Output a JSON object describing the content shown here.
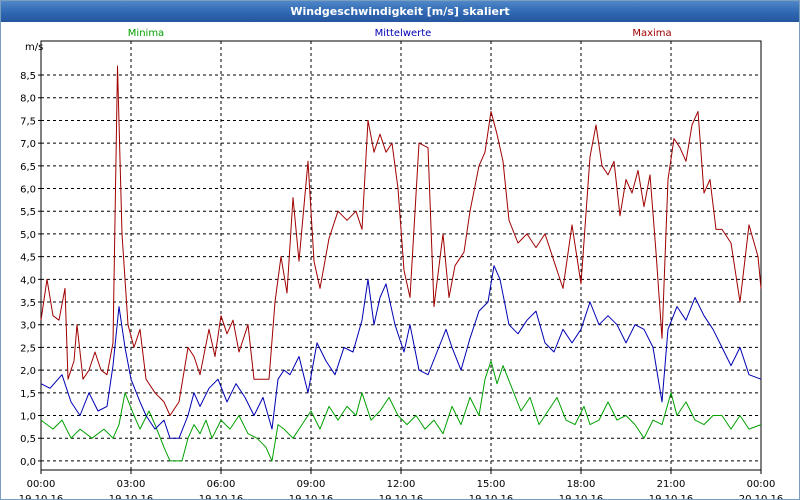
{
  "window": {
    "title": "Windgeschwindigkeit [m/s] skaliert"
  },
  "colors": {
    "minima": "#00a000",
    "mittel": "#0000b4",
    "maxima": "#a00000",
    "grid": "#000000"
  },
  "chart_data": {
    "type": "line",
    "title": "Windgeschwindigkeit [m/s] skaliert",
    "ylabel": "m/s",
    "ylim": [
      -0.2,
      9.25
    ],
    "yticks": [
      "0,0",
      "0,5",
      "1,0",
      "1,5",
      "2,0",
      "2,5",
      "3,0",
      "3,5",
      "4,0",
      "4,5",
      "5,0",
      "5,5",
      "6,0",
      "6,5",
      "7,0",
      "7,5",
      "8,0",
      "8,5"
    ],
    "xlim": [
      0,
      24
    ],
    "xticks": [
      {
        "time": "00:00",
        "date": "19.10.16"
      },
      {
        "time": "03:00",
        "date": "19.10.16"
      },
      {
        "time": "06:00",
        "date": "19.10.16"
      },
      {
        "time": "09:00",
        "date": "19.10.16"
      },
      {
        "time": "12:00",
        "date": "19.10.16"
      },
      {
        "time": "15:00",
        "date": "19.10.16"
      },
      {
        "time": "18:00",
        "date": "19.10.16"
      },
      {
        "time": "21:00",
        "date": "19.10.16"
      },
      {
        "time": "00:00",
        "date": "20.10.16"
      }
    ],
    "grid": true,
    "legend": [
      {
        "name": "Minima",
        "position": "top-left"
      },
      {
        "name": "Mittelwerte",
        "position": "top-center"
      },
      {
        "name": "Maxima",
        "position": "top-right"
      }
    ],
    "series": [
      {
        "name": "Minima",
        "points": [
          [
            0,
            0.9
          ],
          [
            0.4,
            0.7
          ],
          [
            0.7,
            0.9
          ],
          [
            1.0,
            0.5
          ],
          [
            1.3,
            0.7
          ],
          [
            1.7,
            0.5
          ],
          [
            2.1,
            0.7
          ],
          [
            2.4,
            0.5
          ],
          [
            2.6,
            0.8
          ],
          [
            2.8,
            1.5
          ],
          [
            3.1,
            1.0
          ],
          [
            3.3,
            0.7
          ],
          [
            3.6,
            1.1
          ],
          [
            3.8,
            0.8
          ],
          [
            4.1,
            0.3
          ],
          [
            4.3,
            0.0
          ],
          [
            4.7,
            0.0
          ],
          [
            4.9,
            0.5
          ],
          [
            5.1,
            0.8
          ],
          [
            5.3,
            0.6
          ],
          [
            5.5,
            0.9
          ],
          [
            5.7,
            0.5
          ],
          [
            6.0,
            0.9
          ],
          [
            6.3,
            0.7
          ],
          [
            6.6,
            1.0
          ],
          [
            6.9,
            0.6
          ],
          [
            7.2,
            0.5
          ],
          [
            7.5,
            0.3
          ],
          [
            7.7,
            0.0
          ],
          [
            7.9,
            0.8
          ],
          [
            8.1,
            0.7
          ],
          [
            8.4,
            0.5
          ],
          [
            8.7,
            0.8
          ],
          [
            9.0,
            1.1
          ],
          [
            9.3,
            0.7
          ],
          [
            9.6,
            1.2
          ],
          [
            9.9,
            0.9
          ],
          [
            10.2,
            1.2
          ],
          [
            10.5,
            1.0
          ],
          [
            10.7,
            1.5
          ],
          [
            11.0,
            0.9
          ],
          [
            11.3,
            1.1
          ],
          [
            11.6,
            1.4
          ],
          [
            11.9,
            1.0
          ],
          [
            12.2,
            0.8
          ],
          [
            12.5,
            1.0
          ],
          [
            12.8,
            0.7
          ],
          [
            13.1,
            0.9
          ],
          [
            13.4,
            0.6
          ],
          [
            13.7,
            1.2
          ],
          [
            14.0,
            0.8
          ],
          [
            14.3,
            1.4
          ],
          [
            14.6,
            1.0
          ],
          [
            14.8,
            1.8
          ],
          [
            15.0,
            2.2
          ],
          [
            15.2,
            1.7
          ],
          [
            15.4,
            2.1
          ],
          [
            15.7,
            1.6
          ],
          [
            16.0,
            1.1
          ],
          [
            16.3,
            1.4
          ],
          [
            16.6,
            0.8
          ],
          [
            16.9,
            1.1
          ],
          [
            17.2,
            1.4
          ],
          [
            17.5,
            0.9
          ],
          [
            17.8,
            0.8
          ],
          [
            18.1,
            1.2
          ],
          [
            18.3,
            0.8
          ],
          [
            18.6,
            0.9
          ],
          [
            18.9,
            1.3
          ],
          [
            19.2,
            0.9
          ],
          [
            19.5,
            1.0
          ],
          [
            19.8,
            0.8
          ],
          [
            20.1,
            0.5
          ],
          [
            20.4,
            0.9
          ],
          [
            20.7,
            0.8
          ],
          [
            21.0,
            1.5
          ],
          [
            21.2,
            1.0
          ],
          [
            21.5,
            1.3
          ],
          [
            21.8,
            0.9
          ],
          [
            22.1,
            0.8
          ],
          [
            22.4,
            1.0
          ],
          [
            22.7,
            1.0
          ],
          [
            23.0,
            0.7
          ],
          [
            23.3,
            1.0
          ],
          [
            23.6,
            0.7
          ],
          [
            24.0,
            0.8
          ]
        ]
      },
      {
        "name": "Mittelwerte",
        "points": [
          [
            0,
            1.7
          ],
          [
            0.3,
            1.6
          ],
          [
            0.7,
            1.9
          ],
          [
            1.0,
            1.3
          ],
          [
            1.3,
            1.0
          ],
          [
            1.6,
            1.5
          ],
          [
            1.9,
            1.1
          ],
          [
            2.2,
            1.2
          ],
          [
            2.4,
            2.1
          ],
          [
            2.6,
            3.4
          ],
          [
            2.8,
            2.5
          ],
          [
            3.0,
            1.8
          ],
          [
            3.3,
            1.3
          ],
          [
            3.5,
            1.0
          ],
          [
            3.8,
            0.7
          ],
          [
            4.1,
            0.9
          ],
          [
            4.3,
            0.5
          ],
          [
            4.6,
            0.5
          ],
          [
            4.9,
            1.0
          ],
          [
            5.1,
            1.5
          ],
          [
            5.3,
            1.2
          ],
          [
            5.6,
            1.6
          ],
          [
            5.9,
            1.8
          ],
          [
            6.2,
            1.3
          ],
          [
            6.5,
            1.7
          ],
          [
            6.8,
            1.4
          ],
          [
            7.1,
            1.0
          ],
          [
            7.4,
            1.4
          ],
          [
            7.7,
            0.7
          ],
          [
            7.9,
            1.8
          ],
          [
            8.1,
            2.0
          ],
          [
            8.3,
            1.9
          ],
          [
            8.6,
            2.3
          ],
          [
            8.9,
            1.5
          ],
          [
            9.2,
            2.6
          ],
          [
            9.5,
            2.2
          ],
          [
            9.8,
            1.9
          ],
          [
            10.1,
            2.5
          ],
          [
            10.4,
            2.4
          ],
          [
            10.7,
            3.1
          ],
          [
            10.9,
            4.0
          ],
          [
            11.1,
            3.0
          ],
          [
            11.3,
            3.6
          ],
          [
            11.5,
            3.9
          ],
          [
            11.8,
            3.0
          ],
          [
            12.1,
            2.4
          ],
          [
            12.3,
            3.0
          ],
          [
            12.6,
            2.0
          ],
          [
            12.9,
            1.9
          ],
          [
            13.2,
            2.4
          ],
          [
            13.5,
            2.9
          ],
          [
            13.7,
            2.5
          ],
          [
            14.0,
            2.0
          ],
          [
            14.3,
            2.7
          ],
          [
            14.6,
            3.3
          ],
          [
            14.9,
            3.5
          ],
          [
            15.1,
            4.3
          ],
          [
            15.3,
            4.0
          ],
          [
            15.6,
            3.0
          ],
          [
            15.9,
            2.8
          ],
          [
            16.2,
            3.1
          ],
          [
            16.5,
            3.3
          ],
          [
            16.8,
            2.6
          ],
          [
            17.1,
            2.4
          ],
          [
            17.4,
            2.9
          ],
          [
            17.7,
            2.6
          ],
          [
            18.0,
            2.9
          ],
          [
            18.3,
            3.5
          ],
          [
            18.6,
            3.0
          ],
          [
            18.9,
            3.2
          ],
          [
            19.2,
            3.0
          ],
          [
            19.5,
            2.6
          ],
          [
            19.8,
            3.0
          ],
          [
            20.1,
            2.9
          ],
          [
            20.4,
            2.5
          ],
          [
            20.7,
            1.3
          ],
          [
            20.9,
            2.9
          ],
          [
            21.2,
            3.4
          ],
          [
            21.5,
            3.1
          ],
          [
            21.8,
            3.6
          ],
          [
            22.1,
            3.2
          ],
          [
            22.4,
            2.9
          ],
          [
            22.7,
            2.5
          ],
          [
            23.0,
            2.1
          ],
          [
            23.3,
            2.5
          ],
          [
            23.6,
            1.9
          ],
          [
            24.0,
            1.8
          ]
        ]
      },
      {
        "name": "Maxima",
        "points": [
          [
            0,
            3.1
          ],
          [
            0.2,
            4.0
          ],
          [
            0.4,
            3.2
          ],
          [
            0.6,
            3.1
          ],
          [
            0.8,
            3.8
          ],
          [
            0.9,
            1.8
          ],
          [
            1.1,
            2.2
          ],
          [
            1.2,
            3.0
          ],
          [
            1.4,
            1.8
          ],
          [
            1.6,
            2.0
          ],
          [
            1.8,
            2.4
          ],
          [
            2.0,
            2.0
          ],
          [
            2.2,
            1.9
          ],
          [
            2.4,
            2.6
          ],
          [
            2.55,
            8.7
          ],
          [
            2.7,
            5.0
          ],
          [
            2.9,
            3.0
          ],
          [
            3.1,
            2.5
          ],
          [
            3.3,
            2.9
          ],
          [
            3.5,
            1.8
          ],
          [
            3.8,
            1.5
          ],
          [
            4.1,
            1.3
          ],
          [
            4.3,
            1.0
          ],
          [
            4.6,
            1.3
          ],
          [
            4.9,
            2.5
          ],
          [
            5.1,
            2.3
          ],
          [
            5.3,
            1.9
          ],
          [
            5.6,
            2.9
          ],
          [
            5.8,
            2.3
          ],
          [
            6.0,
            3.2
          ],
          [
            6.2,
            2.8
          ],
          [
            6.4,
            3.1
          ],
          [
            6.6,
            2.4
          ],
          [
            6.9,
            3.0
          ],
          [
            7.1,
            1.8
          ],
          [
            7.3,
            1.8
          ],
          [
            7.6,
            1.8
          ],
          [
            7.8,
            3.5
          ],
          [
            8.0,
            4.5
          ],
          [
            8.2,
            3.7
          ],
          [
            8.4,
            5.8
          ],
          [
            8.6,
            4.4
          ],
          [
            8.9,
            6.6
          ],
          [
            9.1,
            4.4
          ],
          [
            9.3,
            3.8
          ],
          [
            9.6,
            4.9
          ],
          [
            9.9,
            5.5
          ],
          [
            10.2,
            5.3
          ],
          [
            10.5,
            5.5
          ],
          [
            10.7,
            5.1
          ],
          [
            10.9,
            7.5
          ],
          [
            11.1,
            6.8
          ],
          [
            11.3,
            7.2
          ],
          [
            11.5,
            6.8
          ],
          [
            11.7,
            7.0
          ],
          [
            11.9,
            6.0
          ],
          [
            12.1,
            4.2
          ],
          [
            12.3,
            3.6
          ],
          [
            12.6,
            7.0
          ],
          [
            12.9,
            6.9
          ],
          [
            13.1,
            3.4
          ],
          [
            13.4,
            5.0
          ],
          [
            13.6,
            3.6
          ],
          [
            13.8,
            4.3
          ],
          [
            14.1,
            4.6
          ],
          [
            14.3,
            5.5
          ],
          [
            14.6,
            6.5
          ],
          [
            14.8,
            6.8
          ],
          [
            15.0,
            7.7
          ],
          [
            15.2,
            7.2
          ],
          [
            15.4,
            6.6
          ],
          [
            15.6,
            5.3
          ],
          [
            15.9,
            4.8
          ],
          [
            16.2,
            5.0
          ],
          [
            16.5,
            4.7
          ],
          [
            16.8,
            5.0
          ],
          [
            17.1,
            4.4
          ],
          [
            17.4,
            3.8
          ],
          [
            17.7,
            5.2
          ],
          [
            18.0,
            3.9
          ],
          [
            18.3,
            6.7
          ],
          [
            18.5,
            7.4
          ],
          [
            18.7,
            6.5
          ],
          [
            18.9,
            6.3
          ],
          [
            19.1,
            6.6
          ],
          [
            19.3,
            5.4
          ],
          [
            19.5,
            6.2
          ],
          [
            19.7,
            5.9
          ],
          [
            19.9,
            6.4
          ],
          [
            20.1,
            5.6
          ],
          [
            20.3,
            6.3
          ],
          [
            20.5,
            4.6
          ],
          [
            20.7,
            2.7
          ],
          [
            20.9,
            6.2
          ],
          [
            21.1,
            7.1
          ],
          [
            21.3,
            6.9
          ],
          [
            21.5,
            6.6
          ],
          [
            21.7,
            7.4
          ],
          [
            21.9,
            7.7
          ],
          [
            22.1,
            5.9
          ],
          [
            22.3,
            6.2
          ],
          [
            22.5,
            5.1
          ],
          [
            22.7,
            5.1
          ],
          [
            23.0,
            4.8
          ],
          [
            23.3,
            3.5
          ],
          [
            23.6,
            5.2
          ],
          [
            23.9,
            4.5
          ],
          [
            24.0,
            3.8
          ]
        ]
      }
    ]
  }
}
